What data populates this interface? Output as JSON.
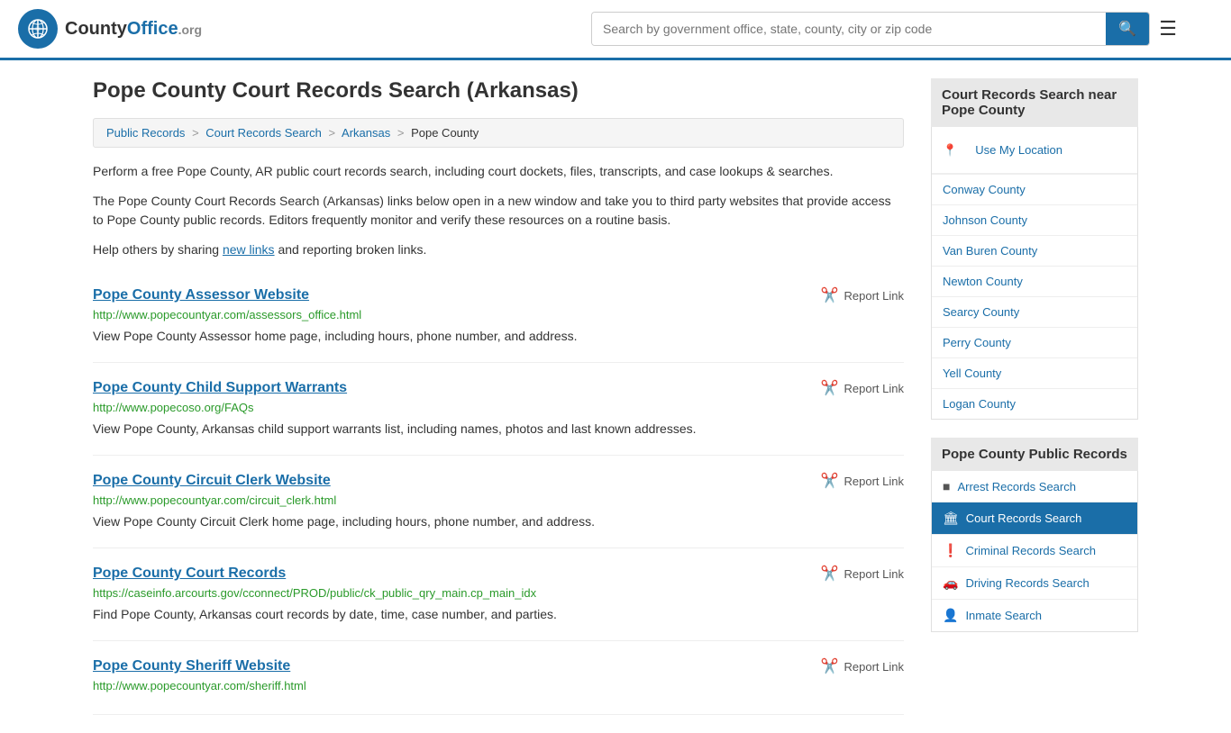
{
  "header": {
    "logo_text": "County",
    "logo_org": "Office",
    "logo_domain": ".org",
    "search_placeholder": "Search by government office, state, county, city or zip code",
    "search_btn_icon": "🔍"
  },
  "page": {
    "title": "Pope County Court Records Search (Arkansas)",
    "breadcrumb": [
      {
        "label": "Public Records",
        "href": "#"
      },
      {
        "label": "Court Records Search",
        "href": "#"
      },
      {
        "label": "Arkansas",
        "href": "#"
      },
      {
        "label": "Pope County",
        "href": "#"
      }
    ],
    "description1": "Perform a free Pope County, AR public court records search, including court dockets, files, transcripts, and case lookups & searches.",
    "description2": "The Pope County Court Records Search (Arkansas) links below open in a new window and take you to third party websites that provide access to Pope County public records. Editors frequently monitor and verify these resources on a routine basis.",
    "description3_prefix": "Help others by sharing ",
    "description3_link": "new links",
    "description3_suffix": " and reporting broken links."
  },
  "results": [
    {
      "title": "Pope County Assessor Website",
      "url": "http://www.popecountyar.com/assessors_office.html",
      "description": "View Pope County Assessor home page, including hours, phone number, and address."
    },
    {
      "title": "Pope County Child Support Warrants",
      "url": "http://www.popecoso.org/FAQs",
      "description": "View Pope County, Arkansas child support warrants list, including names, photos and last known addresses."
    },
    {
      "title": "Pope County Circuit Clerk Website",
      "url": "http://www.popecountyar.com/circuit_clerk.html",
      "description": "View Pope County Circuit Clerk home page, including hours, phone number, and address."
    },
    {
      "title": "Pope County Court Records",
      "url": "https://caseinfo.arcourts.gov/cconnect/PROD/public/ck_public_qry_main.cp_main_idx",
      "description": "Find Pope County, Arkansas court records by date, time, case number, and parties."
    },
    {
      "title": "Pope County Sheriff Website",
      "url": "http://www.popecountyar.com/sheriff.html",
      "description": ""
    }
  ],
  "report_label": "Report Link",
  "sidebar": {
    "nearby_title": "Court Records Search near Pope County",
    "use_location": "Use My Location",
    "nearby_counties": [
      "Conway County",
      "Johnson County",
      "Van Buren County",
      "Newton County",
      "Searcy County",
      "Perry County",
      "Yell County",
      "Logan County"
    ],
    "public_records_title": "Pope County Public Records",
    "public_records_items": [
      {
        "label": "Arrest Records Search",
        "icon": "■",
        "active": false
      },
      {
        "label": "Court Records Search",
        "icon": "🏛",
        "active": true
      },
      {
        "label": "Criminal Records Search",
        "icon": "❗",
        "active": false
      },
      {
        "label": "Driving Records Search",
        "icon": "🚗",
        "active": false
      },
      {
        "label": "Inmate Search",
        "icon": "👤",
        "active": false
      }
    ]
  }
}
